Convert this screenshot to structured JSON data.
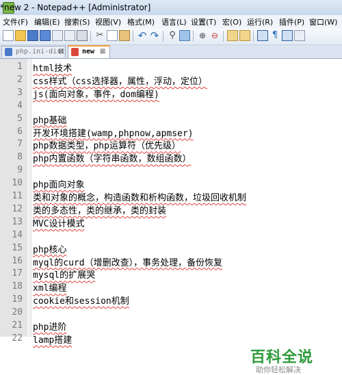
{
  "window": {
    "title": "*new  2 - Notepad++ [Administrator]"
  },
  "menu": [
    "文件(F)",
    "编辑(E)",
    "搜索(S)",
    "视图(V)",
    "格式(M)",
    "语言(L)",
    "设置(T)",
    "宏(O)",
    "运行(R)",
    "插件(P)",
    "窗口(W)"
  ],
  "toolbar": {
    "icons": [
      "new-file-icon",
      "open-file-icon",
      "save-icon",
      "save-all-icon",
      "close-icon",
      "close-all-icon",
      "print-icon",
      "cut-icon",
      "copy-icon",
      "paste-icon",
      "undo-icon",
      "redo-icon",
      "find-icon",
      "replace-icon",
      "zoom-in-icon",
      "zoom-out-icon",
      "sync-v-icon",
      "sync-h-icon",
      "word-wrap-icon",
      "show-all-chars-icon",
      "indent-guide-icon",
      "doc-map-icon"
    ]
  },
  "tabs": [
    {
      "label": "php.ini-dist",
      "active": false
    },
    {
      "label": "new",
      "active": true
    }
  ],
  "editor": {
    "lines": [
      {
        "n": "1",
        "text": "html技术"
      },
      {
        "n": "2",
        "text": "css样式（css选择器，属性，浮动，定位）"
      },
      {
        "n": "3",
        "text": "js(面向对象，事件，dom编程)"
      },
      {
        "n": "4",
        "text": ""
      },
      {
        "n": "5",
        "text": "php基础"
      },
      {
        "n": "6",
        "text": "开发环境搭建(wamp,phpnow,apmser)"
      },
      {
        "n": "7",
        "text": "php数据类型，php运算符（优先级）"
      },
      {
        "n": "8",
        "text": "php内置函数（字符串函数，数组函数）"
      },
      {
        "n": "9",
        "text": ""
      },
      {
        "n": "10",
        "text": "php面向对象"
      },
      {
        "n": "11",
        "text": "类和对象的概念，构造函数和析构函数，垃圾回收机制"
      },
      {
        "n": "12",
        "text": "类的多态性，类的继承，类的封装"
      },
      {
        "n": "13",
        "text": "MVC设计模式"
      },
      {
        "n": "14",
        "text": ""
      },
      {
        "n": "15",
        "text": "php核心"
      },
      {
        "n": "16",
        "text": "myql的curd（增删改查），事务处理，备份恢复"
      },
      {
        "n": "17",
        "text": "mysql的扩展哭"
      },
      {
        "n": "18",
        "text": "xml编程"
      },
      {
        "n": "19",
        "text": "cookie和session机制"
      },
      {
        "n": "20",
        "text": ""
      },
      {
        "n": "21",
        "text": "php进阶"
      },
      {
        "n": "22",
        "text": "lamp搭建"
      }
    ]
  },
  "watermark": {
    "title": "百科全说",
    "subtitle": "助你轻松解决"
  }
}
